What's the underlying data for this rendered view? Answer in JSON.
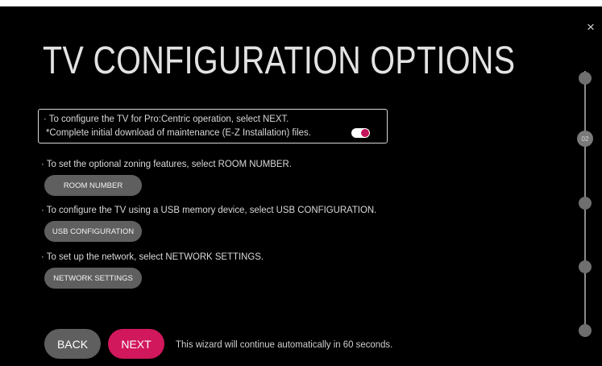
{
  "window": {
    "title": "TV CONFIGURATION OPTIONS",
    "close_glyph": "×"
  },
  "instructions": {
    "proc_line1": "· To configure the TV for Pro:Centric operation, select NEXT.",
    "proc_line2": "*Complete initial download of maintenance (E-Z Installation) files.",
    "toggle_on": true,
    "room_text": "· To set the optional zoning features, select ROOM NUMBER.",
    "usb_text": "· To configure the TV using a USB memory device, select USB CONFIGURATION.",
    "network_text": "· To set up the network, select NETWORK SETTINGS."
  },
  "buttons": {
    "room_number": "ROOM NUMBER",
    "usb_configuration": "USB CONFIGURATION",
    "network_settings": "NETWORK SETTINGS",
    "back": "BACK",
    "next": "NEXT"
  },
  "footer": {
    "auto_message": "This wizard will continue automatically in 60 seconds."
  },
  "progress": {
    "current_step_label": "02",
    "steps_total": 5,
    "current_step": 2
  },
  "colors": {
    "accent": "#d1185c",
    "background": "#000000",
    "button_gray": "#5f5f5f"
  },
  "icons": {
    "close": "close-icon",
    "step": "step-dot-icon"
  }
}
